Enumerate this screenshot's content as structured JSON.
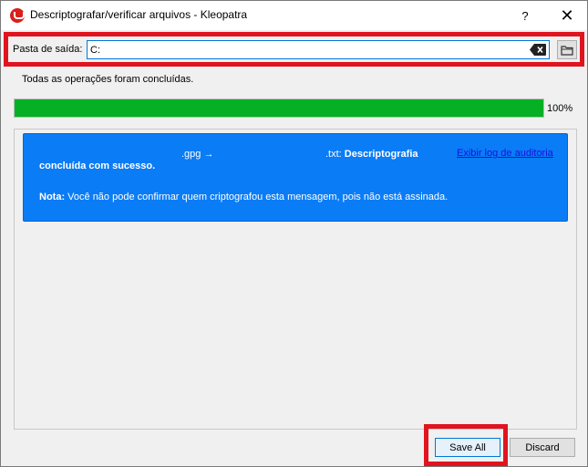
{
  "window": {
    "title": "Descriptografar/verificar arquivos - Kleopatra",
    "help_glyph": "?",
    "close_glyph": "✕"
  },
  "output": {
    "label": "Pasta de saída:",
    "value": "C:"
  },
  "status": {
    "message": "Todas as operações foram concluídas.",
    "progress_percent": 100,
    "progress_label": "100%"
  },
  "result": {
    "gpg_ext": ".gpg →",
    "txt_ext": ".txt:",
    "headline_bold": "Descriptografia",
    "headline_line2": "concluída com sucesso.",
    "note_label": "Nota:",
    "note_text": "Você não pode confirmar quem criptografou esta mensagem, pois não está assinada.",
    "audit_link": "Exibir log de auditoria"
  },
  "buttons": {
    "save_all": "Save All",
    "discard": "Discard"
  },
  "icons": {
    "app": "kleopatra-icon",
    "clear": "clear-text-icon",
    "folder": "folder-icon"
  },
  "colors": {
    "highlight": "#e0141e",
    "progress": "#06b025",
    "result_bg": "#0a7cf6",
    "link": "#1a10e0"
  }
}
